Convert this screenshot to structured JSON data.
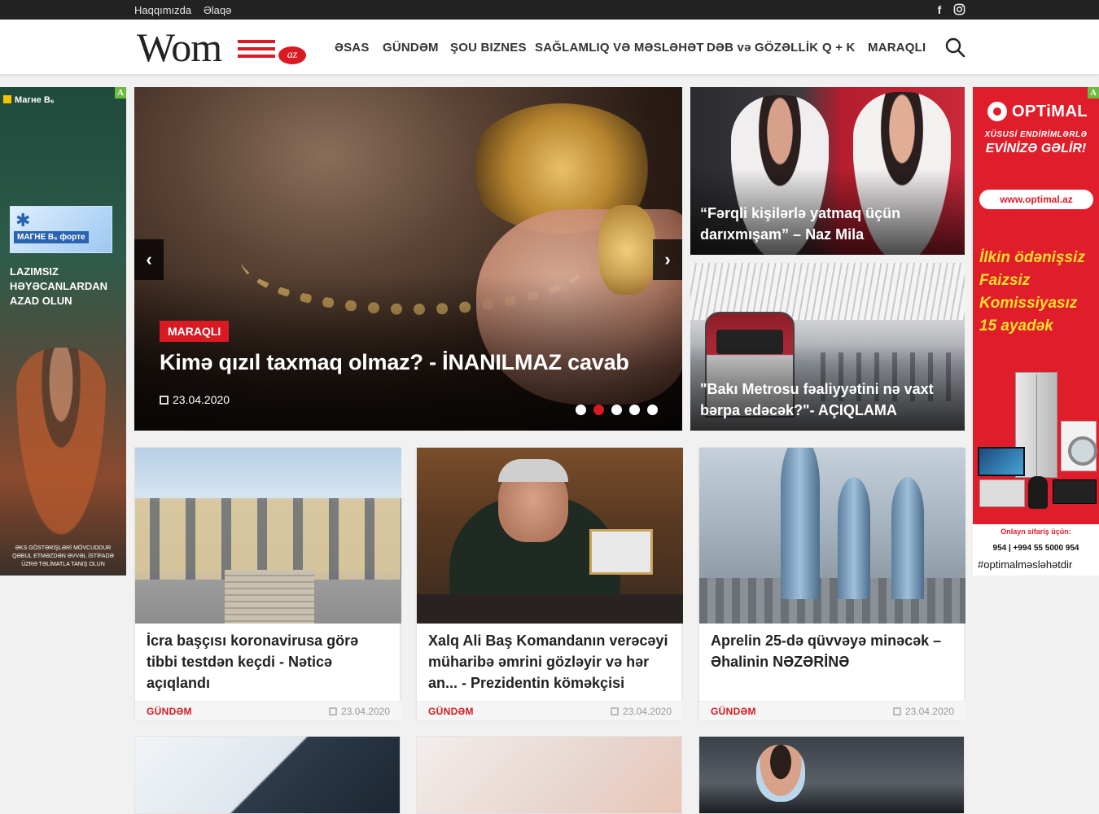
{
  "topbar": {
    "links": [
      "Haqqımızda",
      "Əlaqə"
    ],
    "social": [
      "facebook-icon",
      "instagram-icon"
    ]
  },
  "header": {
    "logo_text": "Wom",
    "logo_suffix": "az",
    "nav": [
      "ƏSAS",
      "GÜNDƏM",
      "ŞOU BIZNES",
      "SAĞLAMLIQ VƏ MƏSLƏHƏT",
      "DƏB və GÖZƏLLİK",
      "Q + K",
      "MARAQLI"
    ],
    "search_icon": "search-icon"
  },
  "ad_left": {
    "brand": "Магне B₆",
    "pack_title": "МАГНЕ B₆ форте",
    "headline": "LAZIMSIZ HƏYƏCANLARDAN AZAD OLUN",
    "fine_print": "ƏKS GÖSTƏRİŞLƏRİ MÖVCUDDUR QƏBUL ETMƏZDƏN ƏVVƏL İSTİFADƏ ÜZRƏ TƏLİMATLA TANIŞ OLUN",
    "badge": "A"
  },
  "ad_right": {
    "brand": "OPTiMAL",
    "line1": "XÜSUSİ ENDİRİMLƏRLƏ",
    "line2": "EVİNİZƏ GƏLİR!",
    "url": "www.optimal.az",
    "promo": [
      "İlkin ödənişsiz",
      "Faizsiz",
      "Komissiyasız",
      "15 ayadək"
    ],
    "order_label": "Onlayn sifariş üçün:",
    "phones": "954 | +994 55 5000 954",
    "hashtag": "#optimalməsləhətdir",
    "badge": "A"
  },
  "hero": {
    "category": "MARAQLI",
    "title": "Kimə qızıl taxmaq olmaz? - İNANILMAZ cavab",
    "date": "23.04.2020",
    "prev": "‹",
    "next": "›",
    "dots": 5,
    "active_dot": 1
  },
  "side_cards": [
    {
      "title": "“Fərqli kişilərlə yatmaq üçün darıxmışam” – Naz Mila"
    },
    {
      "title": "\"Bakı Metrosu fəaliyyətini nə vaxt bərpa edəcək?\"- AÇIQLAMA"
    }
  ],
  "cards": [
    {
      "title": "İcra başçısı koronavirusa görə tibbi testdən keçdi - Nəticə açıqlandı",
      "category": "GÜNDƏM",
      "date": "23.04.2020"
    },
    {
      "title": "Xalq Ali Baş Komandanın verəcəyi müharibə əmrini gözləyir və hər an... - Prezidentin köməkçisi",
      "category": "GÜNDƏM",
      "date": "23.04.2020"
    },
    {
      "title": "Aprelin 25-də qüvvəyə minəcək – Əhalinin NƏZƏRİNƏ",
      "category": "GÜNDƏM",
      "date": "23.04.2020"
    }
  ],
  "colors": {
    "brand_red": "#d91a23",
    "topbar": "#222222",
    "ad_red": "#e01e2b"
  }
}
